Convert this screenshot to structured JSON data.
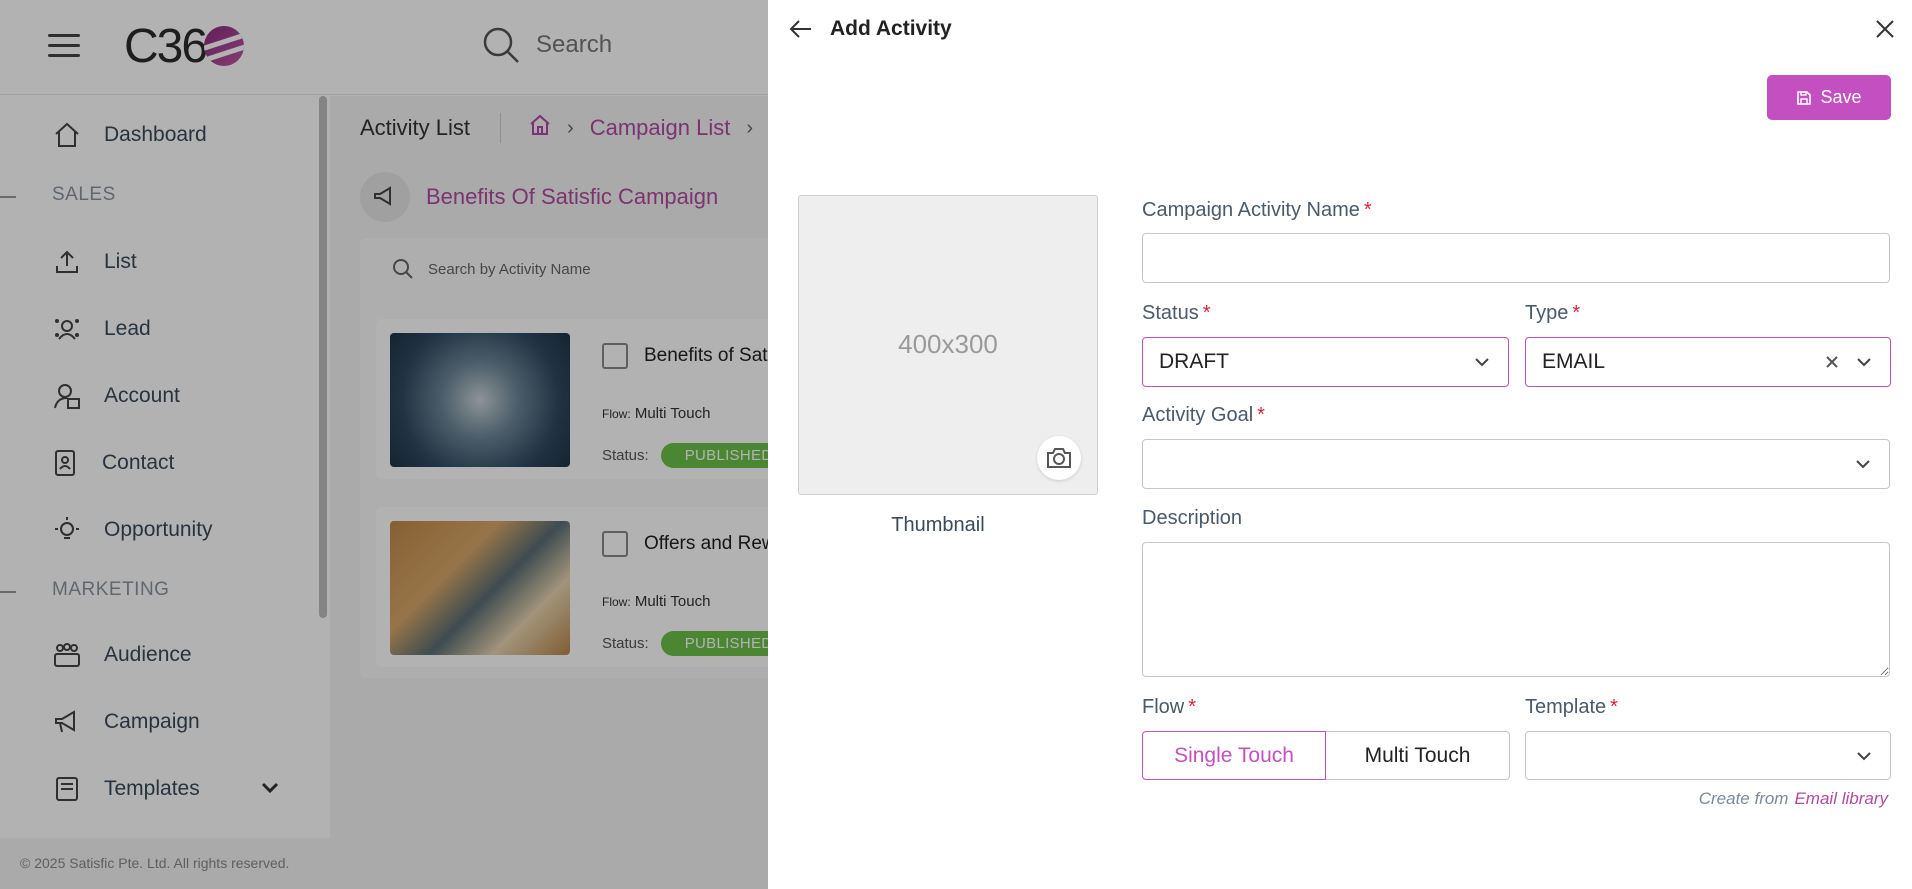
{
  "app": {
    "logo_text": "C36",
    "search_placeholder": "Search",
    "copyright": "© 2025 Satisfic Pte. Ltd. All rights reserved.",
    "sidebar": {
      "items": [
        {
          "label": "Dashboard",
          "icon": "home-icon"
        },
        {
          "section": "SALES"
        },
        {
          "label": "List",
          "icon": "upload-icon"
        },
        {
          "label": "Lead",
          "icon": "lead-icon"
        },
        {
          "label": "Account",
          "icon": "account-icon"
        },
        {
          "label": "Contact",
          "icon": "contact-icon"
        },
        {
          "label": "Opportunity",
          "icon": "lightbulb-icon"
        },
        {
          "section": "MARKETING"
        },
        {
          "label": "Audience",
          "icon": "audience-icon"
        },
        {
          "label": "Campaign",
          "icon": "megaphone-icon"
        },
        {
          "label": "Templates",
          "icon": "templates-icon"
        }
      ]
    },
    "page_title": "Activity List",
    "breadcrumb": {
      "campaign_list": "Campaign List"
    },
    "campaign_name": "Benefits Of Satisfic Campaign",
    "activity_search_placeholder": "Search by Activity Name",
    "cards": [
      {
        "title": "Benefits of Satisfic",
        "flow_label": "Flow:",
        "flow": "Multi Touch",
        "status_label": "Status:",
        "status": "PUBLISHED"
      },
      {
        "title": "Offers and Rewards",
        "flow_label": "Flow:",
        "flow": "Multi Touch",
        "status_label": "Status:",
        "status": "PUBLISHED"
      }
    ]
  },
  "drawer": {
    "title": "Add Activity",
    "save_label": "Save",
    "thumbnail": {
      "size_text": "400x300",
      "label": "Thumbnail"
    },
    "fields": {
      "name": {
        "label": "Campaign Activity Name",
        "value": "",
        "required": "*"
      },
      "status": {
        "label": "Status",
        "value": "DRAFT",
        "required": "*"
      },
      "type": {
        "label": "Type",
        "value": "EMAIL",
        "required": "*"
      },
      "goal": {
        "label": "Activity Goal",
        "value": "",
        "required": "*"
      },
      "description": {
        "label": "Description",
        "value": ""
      },
      "flow": {
        "label": "Flow",
        "required": "*",
        "options": [
          "Single Touch",
          "Multi Touch"
        ],
        "selected": "Single Touch"
      },
      "template": {
        "label": "Template",
        "value": "",
        "required": "*"
      }
    },
    "create_from": {
      "text": "Create from",
      "link": "Email library"
    }
  },
  "colors": {
    "accent": "#c44fc0",
    "link": "#b04ba0",
    "required": "#e0203a",
    "published": "#6cc04a"
  }
}
